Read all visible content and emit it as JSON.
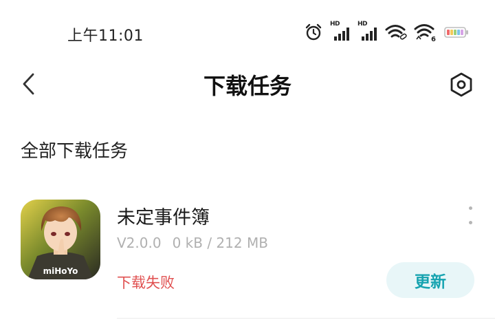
{
  "status_bar": {
    "time": "上午11:01",
    "icons": [
      "alarm-icon",
      "hd-signal-icon",
      "hd-signal-icon",
      "wifi-link-icon",
      "wifi-6-icon",
      "battery-icon"
    ],
    "hd_label": "HD",
    "wifi_badge": "6"
  },
  "header": {
    "title": "下载任务",
    "back_icon": "chevron-left-icon",
    "settings_icon": "hexagon-settings-icon"
  },
  "section": {
    "title": "全部下载任务"
  },
  "tasks": [
    {
      "name": "未定事件簿",
      "version": "V2.0.0",
      "progress": "0 kB / 212 MB",
      "status": "下载失败",
      "status_color": "#e05050",
      "action": "更新",
      "icon_brand": "miHoYo"
    }
  ],
  "colors": {
    "accent": "#16a3b0",
    "accent_bg": "#e8f6f8",
    "error": "#e05050"
  }
}
